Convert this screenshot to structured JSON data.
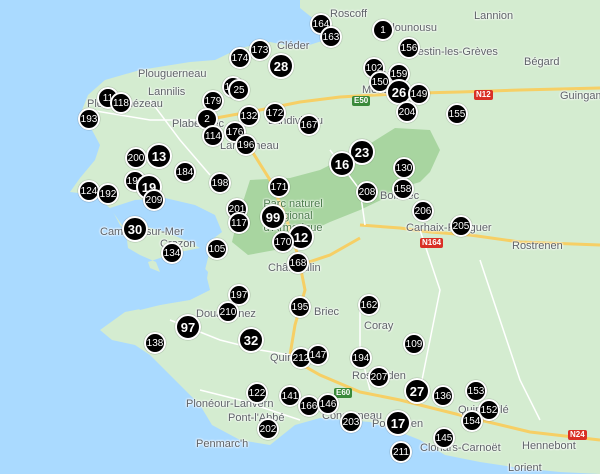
{
  "map": {
    "colors": {
      "sea": "#aadaff",
      "land": "#d4ecd0",
      "park": "#a8d5a0",
      "road": "#f6cf65",
      "marker": "#000000"
    },
    "places": [
      {
        "name": "Lannion"
      },
      {
        "name": "Plounousu"
      },
      {
        "name": "Roscoff"
      },
      {
        "name": "Cléder"
      },
      {
        "name": "Plouguerneau"
      },
      {
        "name": "Lannilis"
      },
      {
        "name": "Ploudalmézeau"
      },
      {
        "name": "Plabennec"
      },
      {
        "name": "Landerneau"
      },
      {
        "name": "Landivisiau"
      },
      {
        "name": "Taulé"
      },
      {
        "name": "Morlaix"
      },
      {
        "name": "Plestin-les-Grèves"
      },
      {
        "name": "Bégard"
      },
      {
        "name": "Guingamp"
      },
      {
        "name": "Parc naturel régional d'Armorique"
      },
      {
        "name": "Camaret-sur-Mer"
      },
      {
        "name": "Crozon"
      },
      {
        "name": "Carhaix-Plouguer"
      },
      {
        "name": "Rostrenen"
      },
      {
        "name": "Châteaulin"
      },
      {
        "name": "Douarnenez"
      },
      {
        "name": "Briec"
      },
      {
        "name": "Coray"
      },
      {
        "name": "Quimper"
      },
      {
        "name": "Rosporden"
      },
      {
        "name": "Plonéour-Lanvern"
      },
      {
        "name": "Pont-l'Abbé"
      },
      {
        "name": "Penmarc'h"
      },
      {
        "name": "Concarneau"
      },
      {
        "name": "Pont-Aven"
      },
      {
        "name": "Quimperlé"
      },
      {
        "name": "Clohars-Carnoët"
      },
      {
        "name": "Hennebont"
      },
      {
        "name": "Lorient"
      },
      {
        "name": "Bolazec"
      }
    ],
    "road_labels": [
      "E50",
      "N12",
      "N164",
      "E60",
      "N24"
    ],
    "markers": [
      "1",
      "164",
      "163",
      "173",
      "174",
      "28",
      "156",
      "102",
      "159",
      "150",
      "26",
      "149",
      "204",
      "155",
      "11",
      "118",
      "193",
      "179",
      "177",
      "25",
      "2",
      "114",
      "132",
      "172",
      "167",
      "176",
      "196",
      "23",
      "16",
      "130",
      "158",
      "208",
      "200",
      "13",
      "184",
      "198",
      "124",
      "192",
      "191",
      "19",
      "209",
      "171",
      "99",
      "201",
      "206",
      "205",
      "30",
      "134",
      "105",
      "117",
      "12",
      "170",
      "168",
      "197",
      "210",
      "97",
      "195",
      "162",
      "138",
      "32",
      "109",
      "194",
      "212",
      "147",
      "207",
      "27",
      "136",
      "153",
      "152",
      "154",
      "122",
      "141",
      "166",
      "146",
      "203",
      "17",
      "145",
      "202",
      "211"
    ]
  }
}
